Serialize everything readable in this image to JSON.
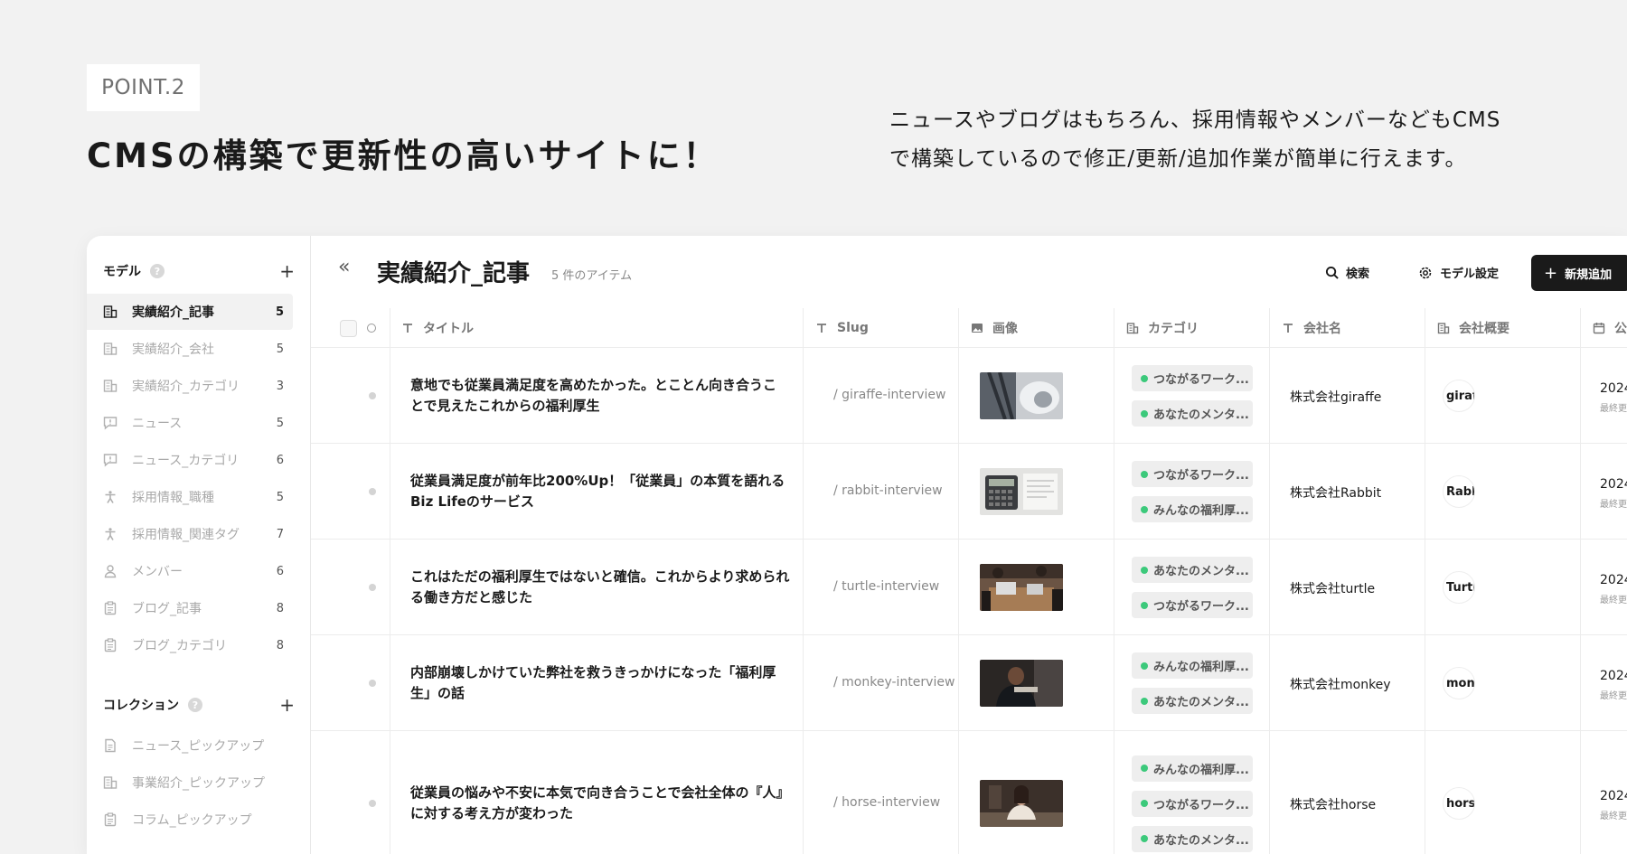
{
  "hero": {
    "badge": "POINT.2",
    "headline": "CMSの構築で更新性の高いサイトに！",
    "description_line1": "ニュースやブログはもちろん、採用情報やメンバーなどもCMS",
    "description_line2": "で構築しているので修正/更新/追加作業が簡単に行えます。"
  },
  "sidebar": {
    "models_label": "モデル",
    "collections_label": "コレクション",
    "help_glyph": "?",
    "add_glyph": "+",
    "models": [
      {
        "label": "実績紹介_記事",
        "count": "5",
        "icon": "building-icon",
        "active": true
      },
      {
        "label": "実績紹介_会社",
        "count": "5",
        "icon": "building-icon"
      },
      {
        "label": "実績紹介_カテゴリ",
        "count": "3",
        "icon": "building-icon"
      },
      {
        "label": "ニュース",
        "count": "5",
        "icon": "message-alert-icon"
      },
      {
        "label": "ニュース_カテゴリ",
        "count": "6",
        "icon": "message-alert-icon"
      },
      {
        "label": "採用情報_職種",
        "count": "5",
        "icon": "person-icon"
      },
      {
        "label": "採用情報_関連タグ",
        "count": "7",
        "icon": "person-icon"
      },
      {
        "label": "メンバー",
        "count": "6",
        "icon": "user-icon"
      },
      {
        "label": "ブログ_記事",
        "count": "8",
        "icon": "clipboard-icon"
      },
      {
        "label": "ブログ_カテゴリ",
        "count": "8",
        "icon": "clipboard-icon"
      }
    ],
    "collections": [
      {
        "label": "ニュース_ピックアップ",
        "icon": "document-icon"
      },
      {
        "label": "事業紹介_ピックアップ",
        "icon": "building-icon"
      },
      {
        "label": "コラム_ピックアップ",
        "icon": "clipboard-icon"
      }
    ]
  },
  "main": {
    "collapse_glyph": "«",
    "title": "実績紹介_記事",
    "item_count": "5 件のアイテム",
    "search_label": "検索",
    "settings_label": "モデル設定",
    "new_label": "新規追加",
    "new_glyph": "+"
  },
  "table": {
    "columns": {
      "title": "タイトル",
      "slug": "Slug",
      "image": "画像",
      "category": "カテゴリ",
      "company": "会社名",
      "overview": "会社概要",
      "last": "公"
    },
    "rows": [
      {
        "title": "意地でも従業員満足度を高めたかった。とことん向き合うことで見えたこれからの福利厚生",
        "slug": "/ giraffe-interview",
        "tags": [
          "つながるワーク...",
          "あなたのメンタ..."
        ],
        "company": "株式会社giraffe",
        "logo": "giraf",
        "date": "2024",
        "date_sub": "最終更"
      },
      {
        "title": "従業員満足度が前年比200%Up！「従業員」の本質を語れるBiz Lifeのサービス",
        "slug": "/ rabbit-interview",
        "tags": [
          "つながるワーク...",
          "みんなの福利厚..."
        ],
        "company": "株式会社Rabbit",
        "logo": "Rabb",
        "date": "2024",
        "date_sub": "最終更"
      },
      {
        "title": "これはただの福利厚生ではないと確信。これからより求められる働き方だと感じた",
        "slug": "/ turtle-interview",
        "tags": [
          "あなたのメンタ...",
          "つながるワーク..."
        ],
        "company": "株式会社turtle",
        "logo": "Turtl",
        "date": "2024",
        "date_sub": "最終更"
      },
      {
        "title": "内部崩壊しかけていた弊社を救うきっかけになった「福利厚生」の話",
        "slug": "/ monkey-interview",
        "tags": [
          "みんなの福利厚...",
          "あなたのメンタ..."
        ],
        "company": "株式会社monkey",
        "logo": "monk",
        "date": "2024",
        "date_sub": "最終更"
      },
      {
        "title": "従業員の悩みや不安に本気で向き合うことで会社全体の『人』に対する考え方が変わった",
        "slug": "/ horse-interview",
        "tags": [
          "みんなの福利厚...",
          "つながるワーク...",
          "あなたのメンタ..."
        ],
        "company": "株式会社horse",
        "logo": "hors",
        "date": "2024",
        "date_sub": "最終更"
      }
    ]
  },
  "colors": {
    "background": "#f2f2f2",
    "accent": "#1a1a1a",
    "tag_dot": "#3cc97b"
  }
}
